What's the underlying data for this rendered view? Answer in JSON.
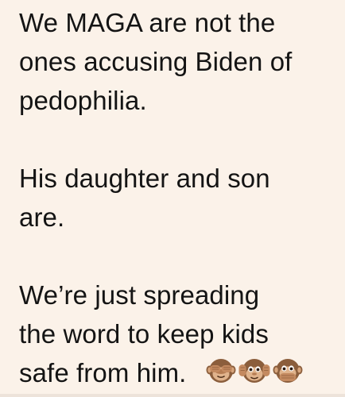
{
  "post": {
    "paragraphs": [
      {
        "lines": [
          "We MAGA are not the",
          "ones accusing Biden of",
          "pedophilia."
        ]
      },
      {
        "lines": [
          "His daughter and son",
          "are."
        ]
      },
      {
        "lines": [
          "We’re just spreading",
          "the word to keep kids",
          "safe from him."
        ]
      }
    ],
    "emojis": [
      "see-no-evil-monkey-icon",
      "hear-no-evil-monkey-icon",
      "speak-no-evil-monkey-icon"
    ]
  }
}
